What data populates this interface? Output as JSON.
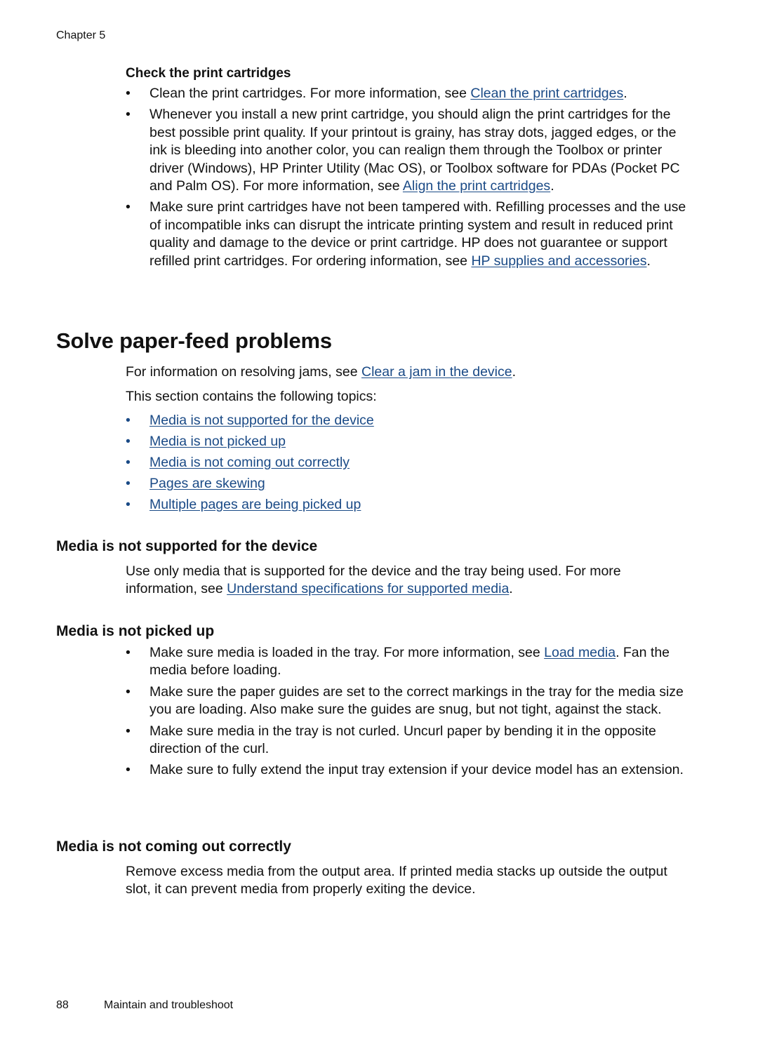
{
  "header": {
    "chapter": "Chapter 5"
  },
  "check_cartridges": {
    "heading": "Check the print cartridges",
    "items": [
      {
        "text": "Clean the print cartridges. For more information, see ",
        "link": "Clean the print cartridges",
        "after": "."
      },
      {
        "text": "Whenever you install a new print cartridge, you should align the print cartridges for the best possible print quality. If your printout is grainy, has stray dots, jagged edges, or the ink is bleeding into another color, you can realign them through the Toolbox or printer driver (Windows), HP Printer Utility (Mac OS), or Toolbox software for PDAs (Pocket PC and Palm OS). For more information, see ",
        "link": "Align the print cartridges",
        "after": "."
      },
      {
        "text": "Make sure print cartridges have not been tampered with. Refilling processes and the use of incompatible inks can disrupt the intricate printing system and result in reduced print quality and damage to the device or print cartridge. HP does not guarantee or support refilled print cartridges. For ordering information, see ",
        "link": "HP supplies and accessories",
        "after": "."
      }
    ]
  },
  "paper_feed": {
    "title": "Solve paper-feed problems",
    "intro": {
      "text": "For information on resolving jams, see ",
      "link": "Clear a jam in the device",
      "after": "."
    },
    "topics_label": "This section contains the following topics:",
    "topics": [
      "Media is not supported for the device",
      "Media is not picked up",
      "Media is not coming out correctly",
      "Pages are skewing",
      "Multiple pages are being picked up"
    ]
  },
  "not_supported": {
    "heading": "Media is not supported for the device",
    "text": "Use only media that is supported for the device and the tray being used. For more information, see ",
    "link": "Understand specifications for supported media",
    "after": "."
  },
  "not_picked": {
    "heading": "Media is not picked up",
    "items": [
      {
        "text": "Make sure media is loaded in the tray. For more information, see ",
        "link": "Load media",
        "after": ". Fan the media before loading."
      },
      {
        "text": "Make sure the paper guides are set to the correct markings in the tray for the media size you are loading. Also make sure the guides are snug, but not tight, against the stack."
      },
      {
        "text": "Make sure media in the tray is not curled. Uncurl paper by bending it in the opposite direction of the curl."
      },
      {
        "text": "Make sure to fully extend the input tray extension if your device model has an extension."
      }
    ]
  },
  "not_coming_out": {
    "heading": "Media is not coming out correctly",
    "text": "Remove excess media from the output area. If printed media stacks up outside the output slot, it can prevent media from properly exiting the device."
  },
  "footer": {
    "page_number": "88",
    "section": "Maintain and troubleshoot"
  },
  "bullet_glyph": "•"
}
